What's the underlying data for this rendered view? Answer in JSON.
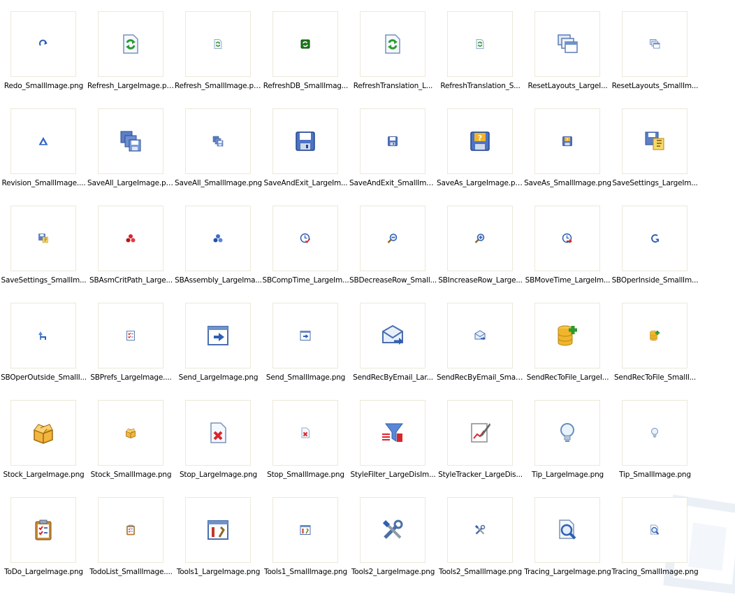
{
  "items": [
    {
      "label": "Redo_SmallImage.png",
      "icon": "redo-icon",
      "size": "small"
    },
    {
      "label": "Refresh_LargeImage.png",
      "icon": "refresh-icon",
      "size": "large"
    },
    {
      "label": "Refresh_SmallImage.png",
      "icon": "refresh-icon",
      "size": "small"
    },
    {
      "label": "RefreshDB_SmallImag...",
      "icon": "refresh-db-icon",
      "size": "small"
    },
    {
      "label": "RefreshTranslation_L...",
      "icon": "refresh-icon",
      "size": "large"
    },
    {
      "label": "RefreshTranslation_S...",
      "icon": "refresh-icon",
      "size": "small"
    },
    {
      "label": "ResetLayouts_LargeI...",
      "icon": "windows-icon",
      "size": "large"
    },
    {
      "label": "ResetLayouts_SmallIm...",
      "icon": "windows-icon",
      "size": "small"
    },
    {
      "label": "Revision_SmallImage....",
      "icon": "revision-icon",
      "size": "small"
    },
    {
      "label": "SaveAll_LargeImage.png",
      "icon": "save-all-icon",
      "size": "large"
    },
    {
      "label": "SaveAll_SmallImage.png",
      "icon": "save-all-icon",
      "size": "small"
    },
    {
      "label": "SaveAndExit_LargeIm...",
      "icon": "floppy-icon",
      "size": "large"
    },
    {
      "label": "SaveAndExit_SmallIma...",
      "icon": "floppy-icon",
      "size": "small"
    },
    {
      "label": "SaveAs_LargeImage.png",
      "icon": "floppy-question-icon",
      "size": "large"
    },
    {
      "label": "SaveAs_SmallImage.png",
      "icon": "floppy-question-icon",
      "size": "small"
    },
    {
      "label": "SaveSettings_LargeIm...",
      "icon": "save-settings-icon",
      "size": "large"
    },
    {
      "label": "SaveSettings_SmallIm...",
      "icon": "save-settings-icon",
      "size": "small"
    },
    {
      "label": "SBAsmCritPath_Large...",
      "icon": "assembly-red-icon",
      "size": "small"
    },
    {
      "label": "SBAssembly_LargeIma...",
      "icon": "assembly-blue-icon",
      "size": "small"
    },
    {
      "label": "SBCompTime_LargeIm...",
      "icon": "clock-check-icon",
      "size": "small"
    },
    {
      "label": "SBDecreaseRow_Small...",
      "icon": "zoom-out-icon",
      "size": "small"
    },
    {
      "label": "SBIncreaseRow_Large...",
      "icon": "zoom-in-icon",
      "size": "small"
    },
    {
      "label": "SBMoveTime_LargeIm...",
      "icon": "clock-arrow-icon",
      "size": "small"
    },
    {
      "label": "SBOperInside_SmallIm...",
      "icon": "arrow-curve-icon",
      "size": "small"
    },
    {
      "label": "SBOperOutside_SmallI...",
      "icon": "arrow-out-icon",
      "size": "small"
    },
    {
      "label": "SBPrefs_LargeImage....",
      "icon": "checklist-icon",
      "size": "small"
    },
    {
      "label": "Send_LargeImage.png",
      "icon": "send-window-icon",
      "size": "large"
    },
    {
      "label": "Send_SmallImage.png",
      "icon": "send-window-icon",
      "size": "small"
    },
    {
      "label": "SendRecByEmail_Lar...",
      "icon": "email-send-icon",
      "size": "large"
    },
    {
      "label": "SendRecByEmail_Small...",
      "icon": "email-send-icon",
      "size": "small"
    },
    {
      "label": "SendRecToFile_LargeI...",
      "icon": "database-add-icon",
      "size": "large"
    },
    {
      "label": "SendRecToFile_SmallI...",
      "icon": "database-add-icon",
      "size": "small"
    },
    {
      "label": "Stock_LargeImage.png",
      "icon": "box-icon",
      "size": "large"
    },
    {
      "label": "Stock_SmallImage.png",
      "icon": "box-icon",
      "size": "small"
    },
    {
      "label": "Stop_LargeImage.png",
      "icon": "document-x-icon",
      "size": "large"
    },
    {
      "label": "Stop_SmallImage.png",
      "icon": "document-x-icon",
      "size": "small"
    },
    {
      "label": "StyleFilter_LargeDisIm...",
      "icon": "filter-icon",
      "size": "large"
    },
    {
      "label": "StyleTracker_LargeDis...",
      "icon": "tracker-icon",
      "size": "large"
    },
    {
      "label": "Tip_LargeImage.png",
      "icon": "lightbulb-icon",
      "size": "large"
    },
    {
      "label": "Tip_SmallImage.png",
      "icon": "lightbulb-icon",
      "size": "small"
    },
    {
      "label": "ToDo_LargeImage.png",
      "icon": "clipboard-icon",
      "size": "large"
    },
    {
      "label": "TodoList_SmallImage....",
      "icon": "clipboard-icon",
      "size": "small"
    },
    {
      "label": "Tools1_LargeImage.png",
      "icon": "tools-window-icon",
      "size": "large"
    },
    {
      "label": "Tools1_SmallImage.png",
      "icon": "tools-window-icon",
      "size": "small"
    },
    {
      "label": "Tools2_LargeImage.png",
      "icon": "wrench-screwdriver-icon",
      "size": "large"
    },
    {
      "label": "Tools2_SmallImage.png",
      "icon": "wrench-screwdriver-icon",
      "size": "small"
    },
    {
      "label": "Tracing_LargeImage.png",
      "icon": "magnifier-doc-icon",
      "size": "large"
    },
    {
      "label": "Tracing_SmallImage.png",
      "icon": "magnifier-doc-icon",
      "size": "small"
    }
  ]
}
